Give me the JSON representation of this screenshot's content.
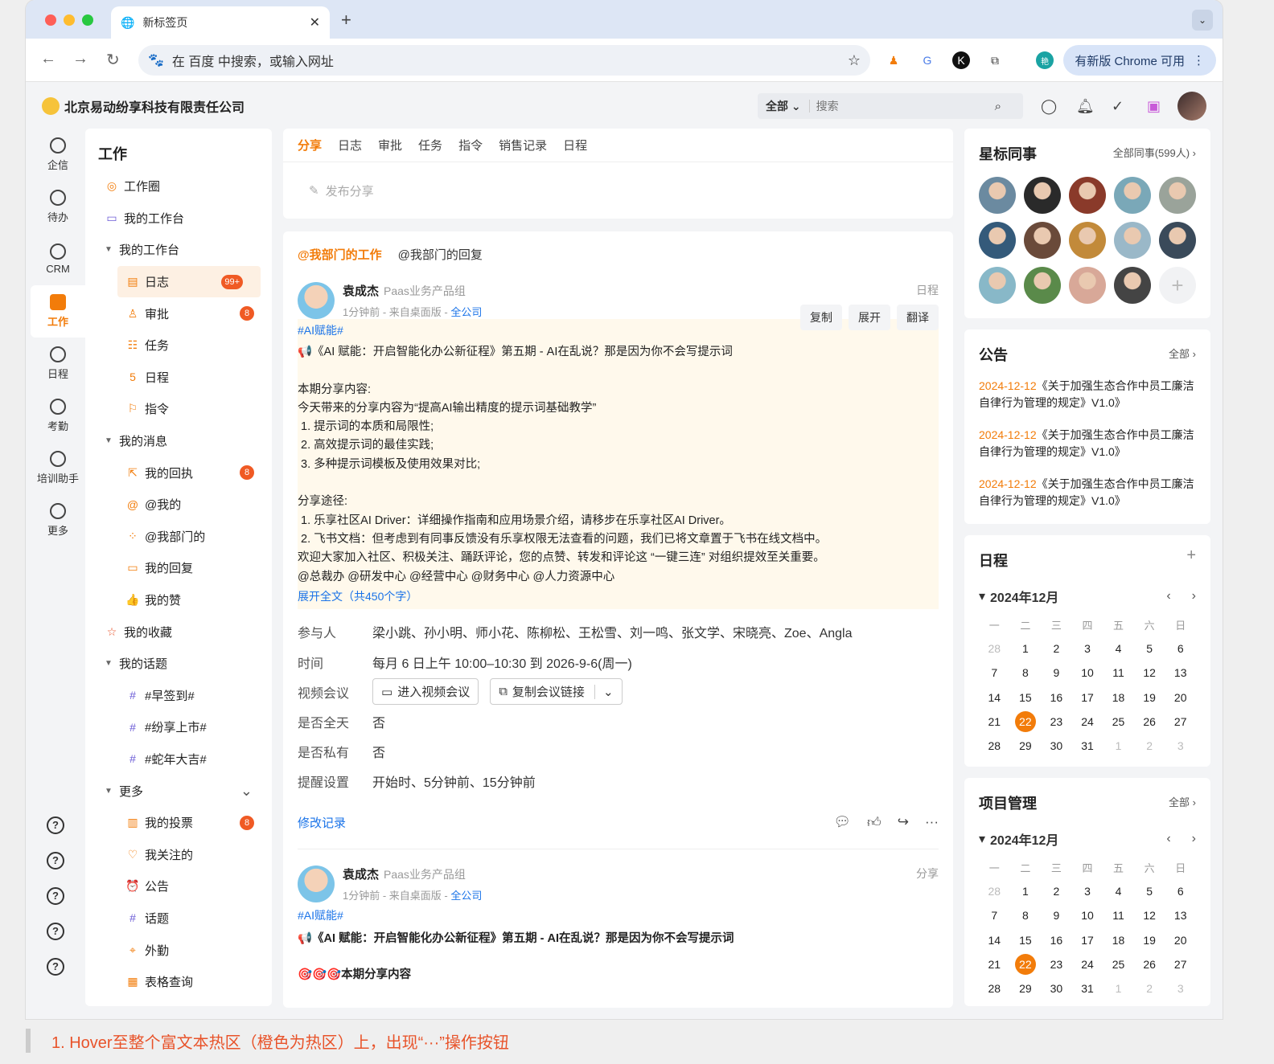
{
  "browser": {
    "tab_title": "新标签页",
    "omnibox": "在 百度 中搜索，或输入网址",
    "update_label": "有新版 Chrome 可用",
    "profile": "艳"
  },
  "app": {
    "company": "北京易动纷享科技有限责任公司",
    "search_scope": "全部",
    "search_placeholder": "搜索"
  },
  "rail": [
    "企信",
    "待办",
    "CRM",
    "工作",
    "日程",
    "考勤",
    "培训助手",
    "更多"
  ],
  "help": "?",
  "sidenav": {
    "title": "工作",
    "items": [
      {
        "label": "工作圈",
        "kind": "lvl1",
        "icon": "◎"
      },
      {
        "label": "我的工作台",
        "kind": "lvl1",
        "icon": "▭"
      },
      {
        "label": "我的工作台",
        "kind": "grp"
      },
      {
        "label": "日志",
        "kind": "sel",
        "icon": "▤",
        "badge": "99+"
      },
      {
        "label": "审批",
        "kind": "lvl2",
        "icon": "♙",
        "badge": "8"
      },
      {
        "label": "任务",
        "kind": "lvl2",
        "icon": "☷"
      },
      {
        "label": "日程",
        "kind": "lvl2",
        "icon": "5"
      },
      {
        "label": "指令",
        "kind": "lvl2",
        "icon": "⚐"
      },
      {
        "label": "我的消息",
        "kind": "grp"
      },
      {
        "label": "我的回执",
        "kind": "lvl2",
        "icon": "⇱",
        "badge": "8"
      },
      {
        "label": "@我的",
        "kind": "lvl2",
        "icon": "@"
      },
      {
        "label": "@我部门的",
        "kind": "lvl2",
        "icon": "⁘"
      },
      {
        "label": "我的回复",
        "kind": "lvl2",
        "icon": "▭"
      },
      {
        "label": "我的赞",
        "kind": "lvl2",
        "icon": "👍"
      },
      {
        "label": "我的收藏",
        "kind": "lvl1",
        "icon": "☆"
      },
      {
        "label": "我的话题",
        "kind": "grp"
      },
      {
        "label": "#早签到#",
        "kind": "lvl2",
        "icon": "#"
      },
      {
        "label": "#纷享上市#",
        "kind": "lvl2",
        "icon": "#"
      },
      {
        "label": "#蛇年大吉#",
        "kind": "lvl2",
        "icon": "#"
      },
      {
        "label": "更多",
        "kind": "grp",
        "chev": "⌄"
      },
      {
        "label": "我的投票",
        "kind": "lvl2",
        "icon": "▥",
        "badge": "8"
      },
      {
        "label": "我关注的",
        "kind": "lvl2",
        "icon": "♡"
      },
      {
        "label": "公告",
        "kind": "lvl2",
        "icon": "⏰"
      },
      {
        "label": "话题",
        "kind": "lvl2",
        "icon": "#"
      },
      {
        "label": "外勤",
        "kind": "lvl2",
        "icon": "⌖"
      },
      {
        "label": "表格查询",
        "kind": "lvl2",
        "icon": "▦"
      }
    ]
  },
  "feed": {
    "tabs": [
      "分享",
      "日志",
      "审批",
      "任务",
      "指令",
      "销售记录",
      "日程"
    ],
    "publish": "发布分享",
    "subtabs": [
      "@我部门的工作",
      "@我部门的回复"
    ],
    "post1": {
      "name": "袁成杰",
      "dept": "Paas业务产品组",
      "meta": "1分钟前 - 来自桌面版 - ",
      "scope": "全公司",
      "type": "日程",
      "buttons": [
        "复制",
        "展开",
        "翻译"
      ],
      "tag": "#AI赋能#",
      "body": "📢《AI 赋能：开启智能化办公新征程》第五期 - AI在乱说？那是因为你不会写提示词\n\n本期分享内容:\n今天带来的分享内容为“提高AI输出精度的提示词基础教学”\n 1. 提示词的本质和局限性;\n 2. 高效提示词的最佳实践;\n 3. 多种提示词模板及使用效果对比;\n\n分享途径:\n 1. 乐享社区AI Driver：详细操作指南和应用场景介绍，请移步在乐享社区AI Driver。\n 2. 飞书文档：但考虑到有同事反馈没有乐享权限无法查看的问题，我们已将文章置于飞书在线文档中。\n欢迎大家加入社区、积极关注、踊跃评论，您的点赞、转发和评论这 “一键三连” 对组织提效至关重要。\n@总裁办 @研发中心 @经营中心 @财务中心 @人力资源中心",
      "more": "展开全文（共450个字）",
      "fields": {
        "participants_k": "参与人",
        "participants": "梁小跳、孙小明、师小花、陈柳松、王松雪、刘一鸣、张文学、宋晓亮、Zoe、Angla",
        "time_k": "时间",
        "time": "每月 6 日上午 10:00–10:30 到 2026-9-6(周一)",
        "video_k": "视频会议",
        "video_btn": "进入视频会议",
        "copy_btn": "复制会议链接",
        "allday_k": "是否全天",
        "allday": "否",
        "private_k": "是否私有",
        "private": "否",
        "remind_k": "提醒设置",
        "remind": "开始时、5分钟前、15分钟前"
      },
      "history": "修改记录"
    },
    "post2": {
      "name": "袁成杰",
      "dept": "Paas业务产品组",
      "meta": "1分钟前 - 来自桌面版 - ",
      "scope": "全公司",
      "type": "分享",
      "tag": "#AI赋能#",
      "line1": "📢《AI 赋能：开启智能化办公新征程》第五期 - AI在乱说？那是因为你不会写提示词",
      "line2": "🎯🎯🎯本期分享内容"
    }
  },
  "right": {
    "star": {
      "title": "星标同事",
      "link": "全部同事(599人)  ›",
      "add": "+"
    },
    "notice": {
      "title": "公告",
      "link": "全部 ›",
      "items": [
        {
          "date": "2024-12-12",
          "text": "《关于加强生态合作中员工廉洁自律行为管理的规定》V1.0》"
        },
        {
          "date": "2024-12-12",
          "text": "《关于加强生态合作中员工廉洁自律行为管理的规定》V1.0》"
        },
        {
          "date": "2024-12-12",
          "text": "《关于加强生态合作中员工廉洁自律行为管理的规定》V1.0》"
        }
      ]
    },
    "schedule": {
      "title": "日程",
      "add": "+",
      "month": "2024年12月"
    },
    "project": {
      "title": "项目管理",
      "link": "全部 ›",
      "month": "2024年12月"
    },
    "weekdays": [
      "一",
      "二",
      "三",
      "四",
      "五",
      "六",
      "日"
    ],
    "days": [
      "28",
      "1",
      "2",
      "3",
      "4",
      "5",
      "6",
      "7",
      "8",
      "9",
      "10",
      "11",
      "12",
      "13",
      "14",
      "15",
      "16",
      "17",
      "18",
      "19",
      "20",
      "21",
      "22",
      "23",
      "24",
      "25",
      "26",
      "27",
      "28",
      "29",
      "30",
      "31",
      "1",
      "2",
      "3"
    ],
    "today": "22"
  },
  "annotation": "1. Hover至整个富文本热区（橙色为热区）上，出现“···”操作按钮",
  "colors": {
    "accent": "#f27c0a",
    "link": "#1a73e8",
    "badge": "#f05a24"
  }
}
